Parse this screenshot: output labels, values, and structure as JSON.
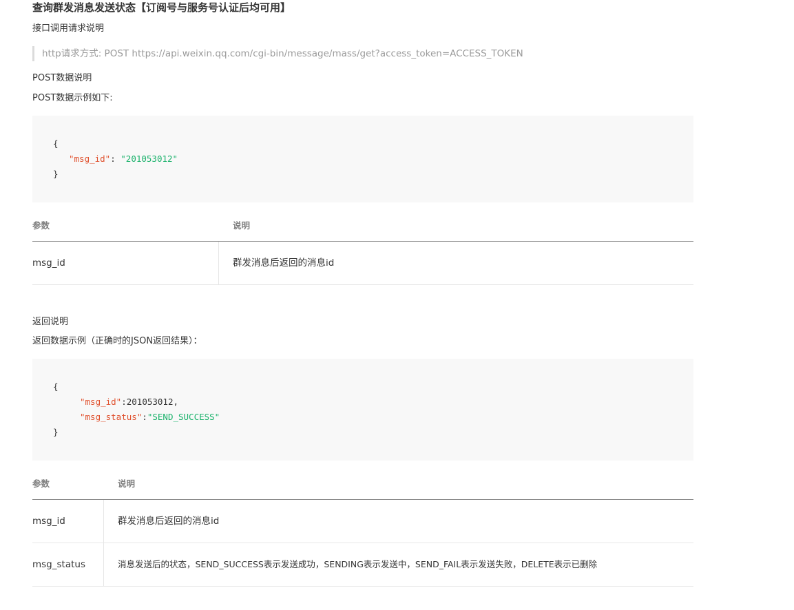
{
  "title": "查询群发消息发送状态【订阅号与服务号认证后均可用】",
  "interface_label": "接口调用请求说明",
  "http_request": "http请求方式: POST https://api.weixin.qq.com/cgi-bin/message/mass/get?access_token=ACCESS_TOKEN",
  "post_data_label": "POST数据说明",
  "post_example_label": "POST数据示例如下:",
  "post_code": {
    "open": "{",
    "key1": "\"msg_id\"",
    "sep1": ": ",
    "val1": "\"201053012\"",
    "close": "}"
  },
  "table1": {
    "headers": [
      "参数",
      "说明"
    ],
    "rows": [
      [
        "msg_id",
        "群发消息后返回的消息id"
      ]
    ]
  },
  "return_label": "返回说明",
  "return_example_label": "返回数据示例（正确时的JSON返回结果）：",
  "return_code": {
    "open": "{",
    "key1": "\"msg_id\"",
    "val1": ":201053012,",
    "key2": "\"msg_status\"",
    "sep2": ":",
    "val2": "\"SEND_SUCCESS\"",
    "close": "}"
  },
  "table2": {
    "headers": [
      "参数",
      "说明"
    ],
    "rows": [
      [
        "msg_id",
        "群发消息后返回的消息id"
      ],
      [
        "msg_status",
        "消息发送后的状态，SEND_SUCCESS表示发送成功，SENDING表示发送中，SEND_FAIL表示发送失败，DELETE表示已删除"
      ]
    ]
  }
}
